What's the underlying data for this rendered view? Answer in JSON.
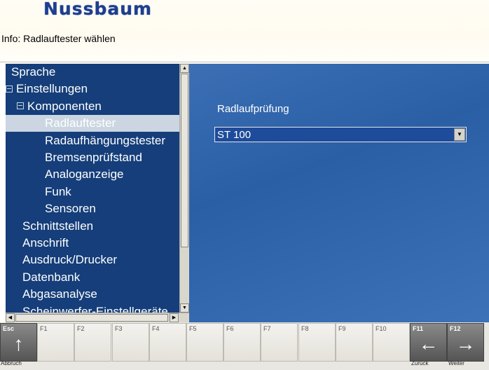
{
  "header": {
    "logo_text": "Nussbaum",
    "info_text": "Info: Radlauftester wählen"
  },
  "tree": {
    "items": [
      {
        "label": "Sprache",
        "indent": 0,
        "expander": false
      },
      {
        "label": "Einstellungen",
        "indent": 0,
        "expander": true
      },
      {
        "label": "Komponenten",
        "indent": 1,
        "expander": true
      },
      {
        "label": "Radlauftester",
        "indent": 2,
        "expander": false,
        "selected": true
      },
      {
        "label": "Radaufhängungstester",
        "indent": 2,
        "expander": false
      },
      {
        "label": "Bremsenprüfstand",
        "indent": 2,
        "expander": false
      },
      {
        "label": "Analoganzeige",
        "indent": 2,
        "expander": false
      },
      {
        "label": "Funk",
        "indent": 2,
        "expander": false
      },
      {
        "label": "Sensoren",
        "indent": 2,
        "expander": false
      },
      {
        "label": "Schnittstellen",
        "indent": 1,
        "expander": false
      },
      {
        "label": "Anschrift",
        "indent": 1,
        "expander": false
      },
      {
        "label": "Ausdruck/Drucker",
        "indent": 1,
        "expander": false
      },
      {
        "label": "Datenbank",
        "indent": 1,
        "expander": false
      },
      {
        "label": "Abgasanalyse",
        "indent": 1,
        "expander": false
      },
      {
        "label": "Scheinwerfer-Einstellgeräte",
        "indent": 1,
        "expander": false
      }
    ]
  },
  "content": {
    "label": "Radlaufprüfung",
    "select_value": "ST 100"
  },
  "fkeys": [
    {
      "key": "Esc",
      "caption": "Abbruch",
      "glyph": "↑",
      "dark": true
    },
    {
      "key": "F1"
    },
    {
      "key": "F2"
    },
    {
      "key": "F3"
    },
    {
      "key": "F4"
    },
    {
      "key": "F5"
    },
    {
      "key": "F6"
    },
    {
      "key": "F7"
    },
    {
      "key": "F8"
    },
    {
      "key": "F9"
    },
    {
      "key": "F10"
    },
    {
      "key": "F11",
      "caption": "Zurück",
      "glyph": "←",
      "dark": true
    },
    {
      "key": "F12",
      "caption": "Weiter",
      "glyph": "→",
      "dark": true
    }
  ],
  "colors": {
    "tree_bg": "#153e7a",
    "content_bg": "#2f63aa",
    "logo": "#1d3f8f"
  }
}
